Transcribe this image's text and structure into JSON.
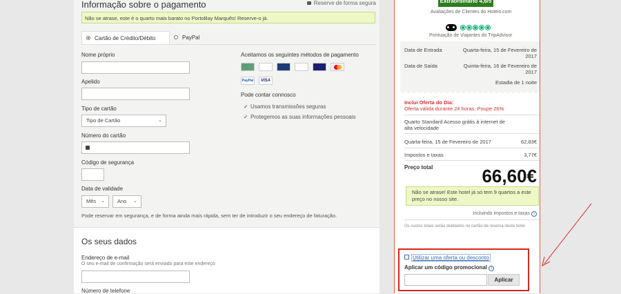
{
  "payment": {
    "title": "Informação sobre o pagamento",
    "secure_label": "Reserve de forma segura",
    "promo_note": "Não se atrase, este é o quarto mais barato no PortoBay Marquês! Reserve-o já.",
    "tabs": [
      {
        "label": "Cartão de Crédito/Débito",
        "selected": true
      },
      {
        "label": "PayPal",
        "selected": false
      }
    ],
    "fields": {
      "first_name_label": "Nome próprio",
      "last_name_label": "Apelido",
      "card_type_label": "Tipo de cartão",
      "card_type_value": "Tipo de Cartão",
      "card_number_label": "Número do cartão",
      "security_code_label": "Código de segurança",
      "expiry_label": "Data de validade",
      "month_value": "Mês",
      "year_value": "Ano"
    },
    "accepted_title": "Aceitamos os seguintes métodos de pagamento",
    "cards": [
      "card-generic",
      "cetelem",
      "diners",
      "card-blue",
      "visa-electron",
      "mastercard",
      "paypal",
      "visa"
    ],
    "contact_title": "Pode contar connosco",
    "checks": [
      "Usamos transmissões seguras",
      "Protegemos as suas informações pessoais"
    ],
    "bottom_note": "Pode reservar em segurança, e de forma ainda mais rápida, sem ter de introduzir o seu endereço de faturação."
  },
  "details": {
    "title": "Os seus dados",
    "email_label": "Endereço de e-mail",
    "email_hint": "O seu e-mail de confirmação será enviado para este endereço",
    "phone_label": "Número de telefone"
  },
  "summary": {
    "rating_badge": "Extraordinário 4,6/5",
    "rating_caption": "Avaliações de Clientes do Hoteis.com",
    "ta_caption": "Pontuação de Viajantes do TripAdvisor",
    "checkin_label": "Data de Entrada",
    "checkin_value": "Quarta-feira, 15 de Fevereiro de 2017",
    "checkout_label": "Data de Saída",
    "checkout_value": "Quinta-feira, 16 de Fevereiro de 2017",
    "stay": "Estadia de 1 noite",
    "offer_title": "Inclui Oferta do Dia:",
    "offer_text": "Oferta válida durante 24 horas: Poupe 26%",
    "room": "Quarto Standard Acesso grátis à internet de alta velocidade",
    "line1_label": "Quarta-feira, 15 de Fevereiro de 2017",
    "line1_value": "62,83€",
    "taxes_label": "Impostos e taxas",
    "taxes_value": "3,77€",
    "total_label": "Preço total",
    "total_value": "66,60€",
    "warning": "Não se atrase! Este hotel já só tem 9 quartos a este preço no nosso site.",
    "includes_taxes": "Incluindo impostos e taxas",
    "fine_print": "Os custos totais serão debitados no cartão de reserva deste hotel",
    "use_offer": "Utilizar uma oferta ou desconto",
    "promo_code_label": "Aplicar um código promocional",
    "apply_button": "Aplicar"
  },
  "colors": {
    "accent_green": "#2f7d1f",
    "highlight_red": "#d7261c",
    "promo_bg": "#eef8c6"
  }
}
